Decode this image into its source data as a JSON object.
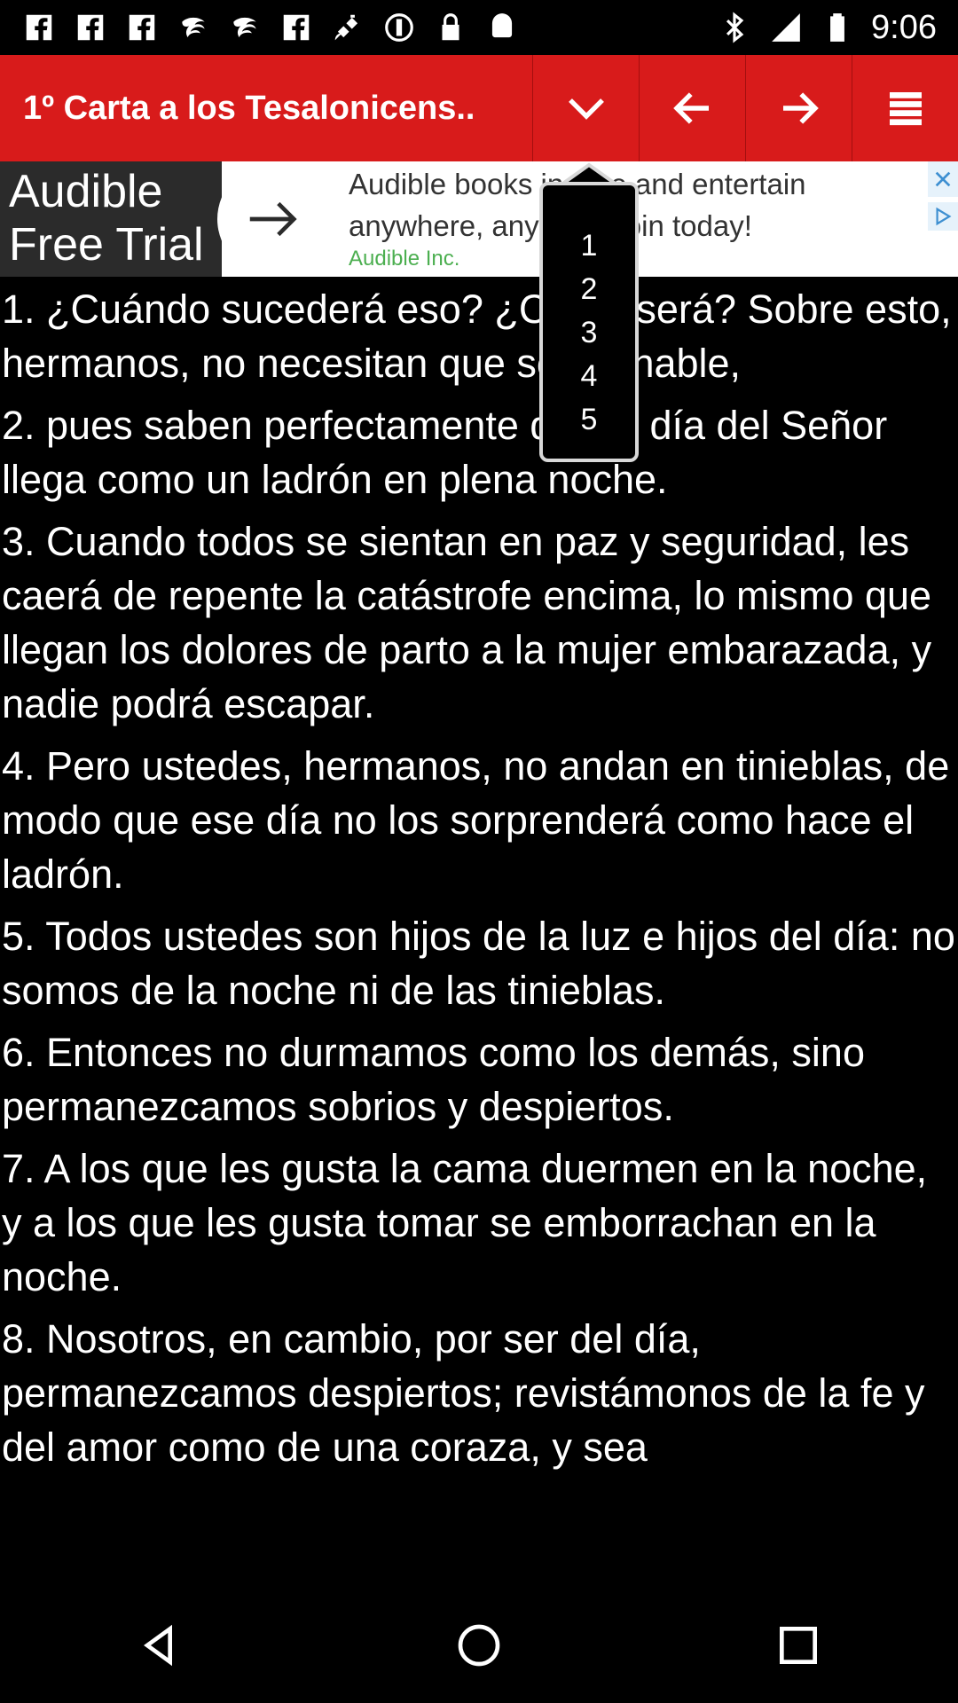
{
  "status_bar": {
    "time": "9:06",
    "left_icons": [
      "facebook-icon",
      "facebook-icon",
      "facebook-icon",
      "logo-icon",
      "logo-icon",
      "facebook-icon",
      "satellite-icon",
      "circle-icon",
      "lock-icon",
      "android-icon"
    ],
    "right_icons": [
      "bluetooth-icon",
      "signal-icon",
      "battery-icon"
    ]
  },
  "app_bar": {
    "title": "1º Carta a los Tesalonicens..",
    "chapter_dropdown_icon": "chevron-down-icon",
    "prev_icon": "arrow-left-icon",
    "next_icon": "arrow-right-icon",
    "menu_icon": "menu-icon",
    "color": "#d81b1b"
  },
  "ad": {
    "left_title": "Audible\nFree Trial",
    "text": "Audible books inspire and entertain anywhere, anytime. Join today!",
    "advertiser": "Audible Inc."
  },
  "chapter_popup": {
    "items": [
      "1",
      "2",
      "3",
      "4",
      "5"
    ]
  },
  "verses": [
    "1. ¿Cuándo sucederá eso? ¿Cómo será? Sobre esto, hermanos, no necesitan que se les hable,",
    "2. pues saben perfectamente que el día del Señor llega como un ladrón en plena noche.",
    "3. Cuando todos se sientan en paz y seguridad, les caerá de repente la catástrofe encima, lo mismo que llegan los dolores de parto a la mujer embarazada, y nadie podrá escapar.",
    "4. Pero ustedes, hermanos, no andan en tinieblas, de modo que ese día no los sorprenderá como hace el ladrón.",
    "5. Todos ustedes son hijos de la luz e hijos del día: no somos de la noche ni de las tinieblas.",
    "6. Entonces no durmamos como los demás, sino permanezcamos sobrios y despiertos.",
    "7. A los que les gusta la cama duermen en la noche, y a los que les gusta tomar se emborrachan en la noche.",
    "8. Nosotros, en cambio, por ser del día, permanezcamos despiertos; revistámonos de la fe y del amor como de una coraza, y sea"
  ],
  "nav_bar": {
    "icons": [
      "back-icon",
      "home-icon",
      "recents-icon"
    ]
  }
}
